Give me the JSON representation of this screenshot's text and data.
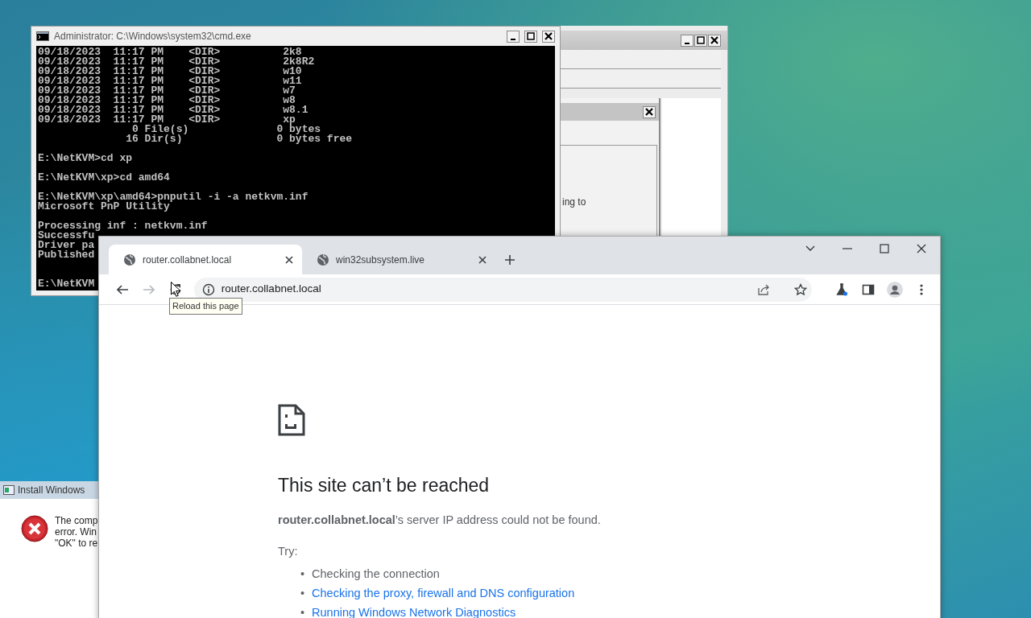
{
  "cmd_window": {
    "title": "Administrator: C:\\Windows\\system32\\cmd.exe",
    "blocks": [
      {
        "lines": [
          "09/18/2023  11:17 PM    <DIR>          2k8",
          "09/18/2023  11:17 PM    <DIR>          2k8R2",
          "09/18/2023  11:17 PM    <DIR>          w10",
          "09/18/2023  11:17 PM    <DIR>          w11",
          "09/18/2023  11:17 PM    <DIR>          w7",
          "09/18/2023  11:17 PM    <DIR>          w8",
          "09/18/2023  11:17 PM    <DIR>          w8.1",
          "09/18/2023  11:17 PM    <DIR>          xp",
          "               0 File(s)              0 bytes",
          "              16 Dir(s)               0 bytes free"
        ]
      },
      {
        "lines": [
          "E:\\NetKVM>cd xp"
        ]
      },
      {
        "lines": [
          "E:\\NetKVM\\xp>cd amd64"
        ]
      },
      {
        "lines": [
          "E:\\NetKVM\\xp\\amd64>pnputil -i -a netkvm.inf",
          "Microsoft PnP Utility"
        ]
      },
      {
        "lines": [
          "Processing inf : netkvm.inf",
          "Successfu",
          "Driver pa",
          "Published"
        ]
      },
      {
        "lines": [
          "E:\\NetKVM"
        ]
      }
    ]
  },
  "back_window": {
    "text": "ing to"
  },
  "install_dialog": {
    "title": "Install Windows",
    "lines": [
      "The comp",
      "error. Win",
      "\"OK\" to re"
    ]
  },
  "browser": {
    "tabs": [
      {
        "title": "router.collabnet.local",
        "selected": true
      },
      {
        "title": "win32subsystem.live",
        "selected": false
      }
    ],
    "back_disabled": false,
    "forward_disabled": true,
    "address": "router.collabnet.local",
    "tooltip": "Reload this page",
    "error_page": {
      "heading": "This site can’t be reached",
      "message": "**router.collabnet.local**’s server IP address could not be found.",
      "try_label": "Try:",
      "suggestions": [
        {
          "marker": "•",
          "text": "Checking the connection",
          "kind": "text"
        },
        {
          "marker": "•",
          "text": "Checking the proxy, firewall and DNS configuration",
          "kind": "link"
        },
        {
          "marker": "•",
          "text": "Running Windows Network Diagnostics",
          "kind": "link"
        }
      ]
    }
  }
}
